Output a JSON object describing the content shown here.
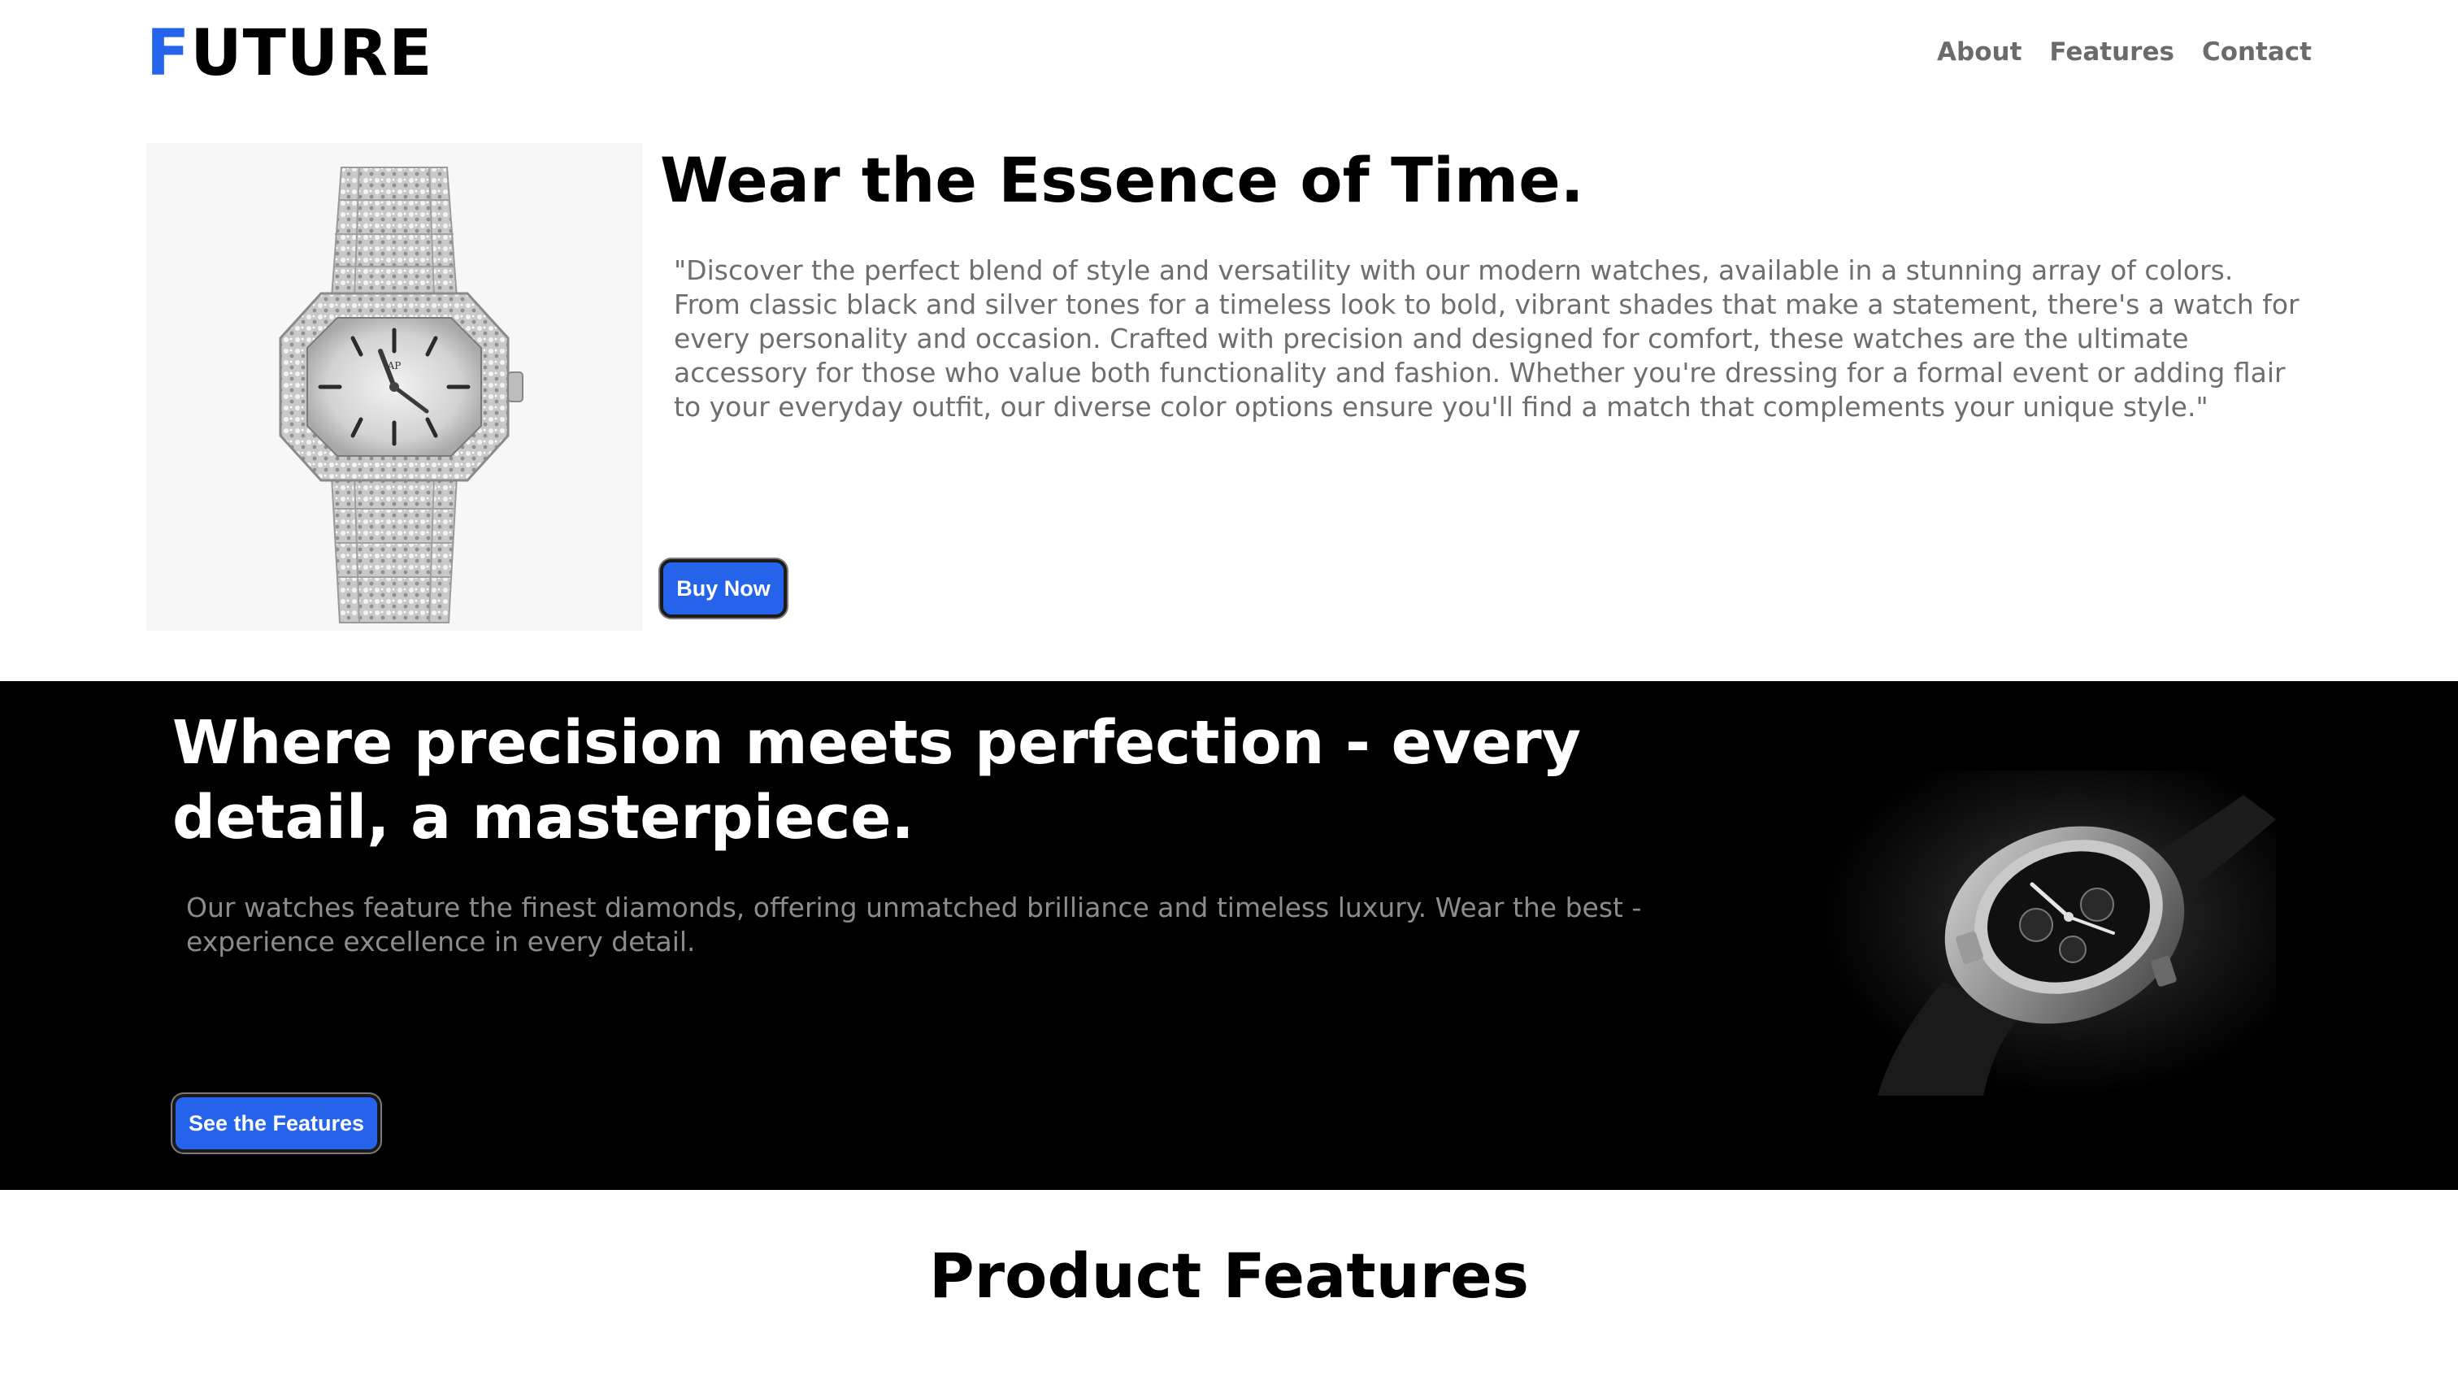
{
  "brand": {
    "logo_first_letter": "F",
    "logo_rest": "UTURE",
    "accent_color": "#2563eb"
  },
  "nav": {
    "items": [
      "About",
      "Features",
      "Contact"
    ]
  },
  "hero": {
    "title": "Wear the Essence of Time.",
    "description": "\"Discover the perfect blend of style and versatility with our modern watches, available in a stunning array of colors. From classic black and silver tones for a timeless look to bold, vibrant shades that make a statement, there's a watch for every personality and occasion. Crafted with precision and designed for comfort, these watches are the ultimate accessory for those who value both functionality and fashion. Whether you're dressing for a formal event or adding flair to your everyday outfit, our diverse color options ensure you'll find a match that complements your unique style.\"",
    "cta_label": "Buy Now",
    "image_icon": "diamond-watch-image"
  },
  "precision": {
    "title": "Where precision meets perfection - every detail, a masterpiece.",
    "description": "Our watches feature the finest diamonds, offering unmatched brilliance and timeless luxury. Wear the best - experience excellence in every detail.",
    "cta_label": "See the Features",
    "image_icon": "sport-watch-image",
    "background_color": "#000000"
  },
  "features": {
    "title": "Product Features"
  }
}
